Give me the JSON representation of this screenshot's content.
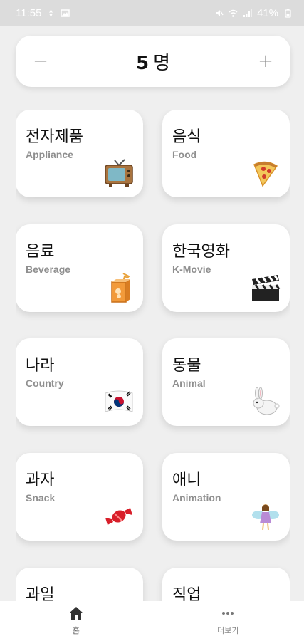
{
  "status_bar": {
    "time": "11:55",
    "battery": "41%"
  },
  "stepper": {
    "minus_label": "−",
    "count": "5",
    "unit": "명",
    "plus_label": "+"
  },
  "categories": [
    {
      "title": "전자제품",
      "subtitle": "Appliance",
      "icon": "tv-icon"
    },
    {
      "title": "음식",
      "subtitle": "Food",
      "icon": "pizza-icon"
    },
    {
      "title": "음료",
      "subtitle": "Beverage",
      "icon": "juice-box-icon"
    },
    {
      "title": "한국영화",
      "subtitle": "K-Movie",
      "icon": "clapper-board-icon"
    },
    {
      "title": "나라",
      "subtitle": "Country",
      "icon": "korea-flag-icon"
    },
    {
      "title": "동물",
      "subtitle": "Animal",
      "icon": "rabbit-icon"
    },
    {
      "title": "과자",
      "subtitle": "Snack",
      "icon": "candy-icon"
    },
    {
      "title": "애니",
      "subtitle": "Animation",
      "icon": "fairy-icon"
    },
    {
      "title": "과일",
      "subtitle": "",
      "icon": ""
    },
    {
      "title": "직업",
      "subtitle": "",
      "icon": ""
    }
  ],
  "bottom_nav": {
    "items": [
      {
        "label": "홈",
        "icon": "home-icon"
      },
      {
        "label": "더보기",
        "icon": "more-icon"
      }
    ]
  },
  "colors": {
    "background": "#efefef",
    "card": "#ffffff",
    "status_bar": "#dcdcdc"
  }
}
